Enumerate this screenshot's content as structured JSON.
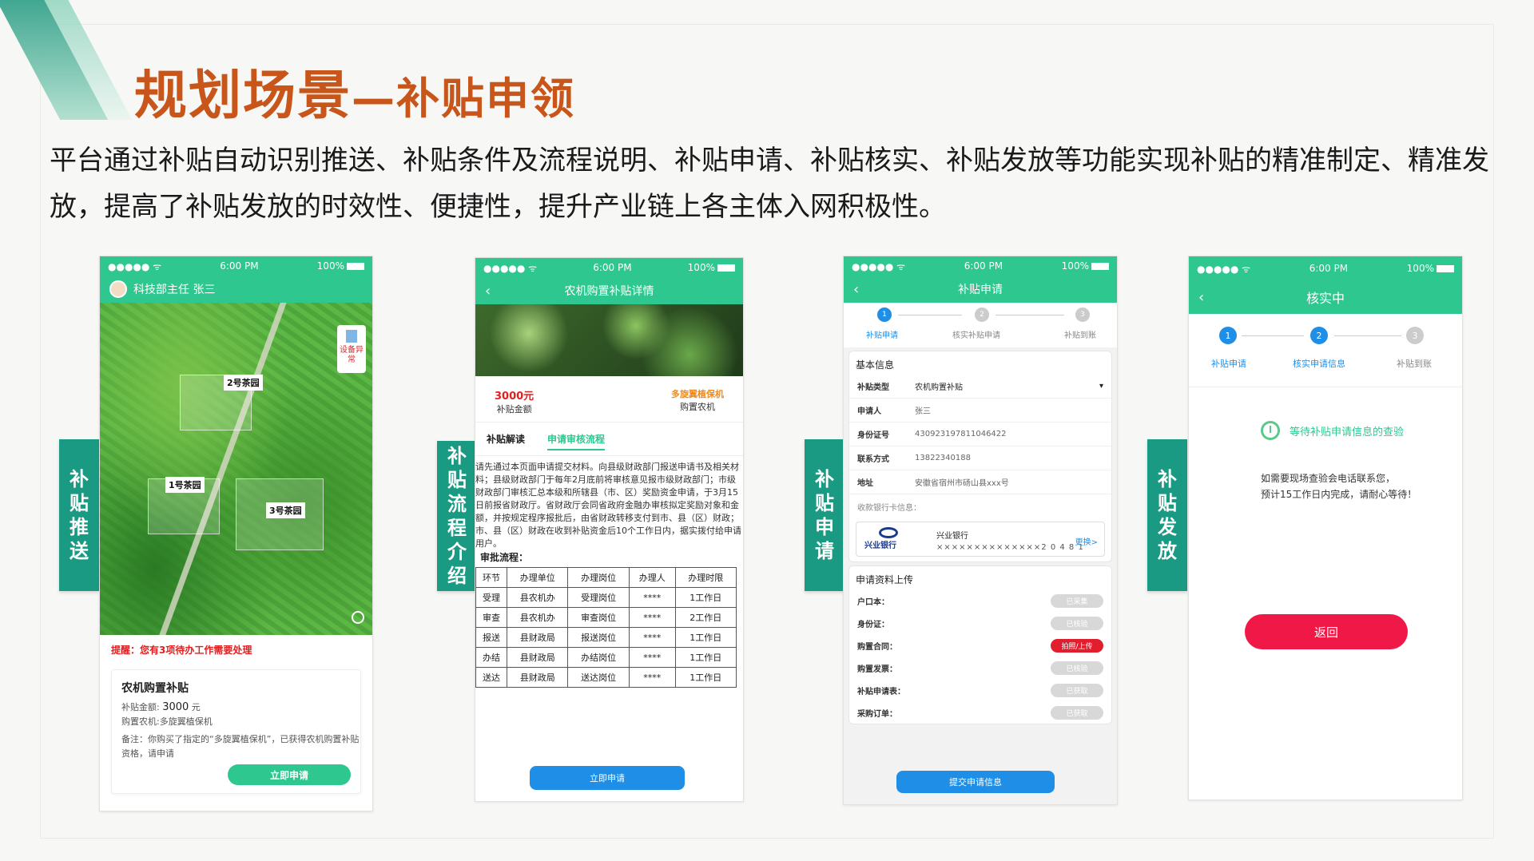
{
  "slide": {
    "title": "规划场景",
    "title_sub": "—补贴申领",
    "description": "平台通过补贴自动识别推送、补贴条件及流程说明、补贴申请、补贴核实、补贴发放等功能实现补贴的精准制定、精准发放，提高了补贴发放的时效性、便捷性，提升产业链上各主体入网积极性。"
  },
  "labels": {
    "push": [
      "补",
      "贴",
      "推",
      "送"
    ],
    "flow": [
      "补",
      "贴",
      "流",
      "程",
      "介",
      "绍"
    ],
    "apply": [
      "补",
      "贴",
      "申",
      "请"
    ],
    "issue": [
      "补",
      "贴",
      "发",
      "放"
    ]
  },
  "status": {
    "carrier": "●●●●● ᯤ",
    "time": "6:00 PM",
    "battery": "100%"
  },
  "phone1": {
    "user": "科技部主任  张三",
    "device_alert": "设备异常",
    "gardens": [
      "2号茶园",
      "1号茶园",
      "3号茶园"
    ],
    "reminder": "提醒：您有3项待办工作需要处理",
    "card_title": "农机购置补贴",
    "amount_label": "补贴金额: ",
    "amount_value": "3000",
    "amount_unit": " 元",
    "machine": "购置农机:多旋翼植保机",
    "remark": "备注：你购买了指定的“多旋翼植保机”，已获得农机购置补贴资格，请申请",
    "apply_btn": "立即申请"
  },
  "phone2": {
    "nav_title": "农机购置补贴详情",
    "amount_value": "3000元",
    "amount_label": "补贴金额",
    "machine_value": "多旋翼植保机",
    "machine_label": "购置农机",
    "tab1": "补贴解读",
    "tab2": "申请审核流程",
    "text": "请先通过本页面申请提交材料。向县级财政部门报送申请书及相关材料；县级财政部门于每年2月底前将审核意见报市级财政部门；市级财政部门审核汇总本级和所辖县（市、区）奖励资金申请，于3月15日前报省财政厅。省财政厅会同省政府金融办审核拟定奖励对象和金额，并按规定程序报批后，由省财政转移支付到市、县（区）财政；市、县（区）财政在收到补贴资金后10个工作日内，据实拨付给申请用户。",
    "process_title": "审批流程：",
    "table_header": [
      "环节",
      "办理单位",
      "办理岗位",
      "办理人",
      "办理时限"
    ],
    "table_rows": [
      [
        "受理",
        "县农机办",
        "受理岗位",
        "****",
        "1工作日"
      ],
      [
        "审查",
        "县农机办",
        "审查岗位",
        "****",
        "2工作日"
      ],
      [
        "报送",
        "县财政局",
        "报送岗位",
        "****",
        "1工作日"
      ],
      [
        "办结",
        "县财政局",
        "办结岗位",
        "****",
        "1工作日"
      ],
      [
        "送达",
        "县财政局",
        "送达岗位",
        "****",
        "1工作日"
      ]
    ],
    "apply_btn": "立即申请"
  },
  "phone3": {
    "nav_title": "补贴申请",
    "steps": [
      "补贴申请",
      "核实补贴申请",
      "补贴到账"
    ],
    "basic_title": "基本信息",
    "fields": [
      {
        "k": "补贴类型",
        "v": "农机购置补贴"
      },
      {
        "k": "申请人",
        "v": "张三"
      },
      {
        "k": "身份证号",
        "v": "430923197811046422"
      },
      {
        "k": "联系方式",
        "v": "13822340188"
      },
      {
        "k": "地址",
        "v": "安徽省宿州市砀山县xxx号"
      }
    ],
    "bank_label": "收款银行卡信息：",
    "bank_logo": "兴业银行",
    "bank_name": "兴业银行",
    "bank_num": "××××××××××××××2 0 4 8 1",
    "bank_change": "更换>",
    "upload_title": "申请资料上传",
    "uploads": [
      {
        "k": "户口本：",
        "v": "已采集"
      },
      {
        "k": "身份证：",
        "v": "已核验"
      },
      {
        "k": "购置合同：",
        "v": "拍照/上传"
      },
      {
        "k": "购置发票：",
        "v": "已核验"
      },
      {
        "k": "补贴申请表：",
        "v": "已获取"
      },
      {
        "k": "采购订单：",
        "v": "已获取"
      }
    ],
    "submit_btn": "提交申请信息"
  },
  "phone4": {
    "nav_title": "核实中",
    "steps": [
      "补贴申请",
      "核实申请信息",
      "补贴到账"
    ],
    "wait_text": "等待补贴申请信息的查验",
    "note1": "如需要现场查验会电话联系您，",
    "note2": "预计15工作日内完成，请耐心等待！",
    "back_btn": "返回"
  },
  "colors": {
    "accent": "#2ec78f",
    "title": "#c8561b",
    "side": "#1a9a82"
  }
}
